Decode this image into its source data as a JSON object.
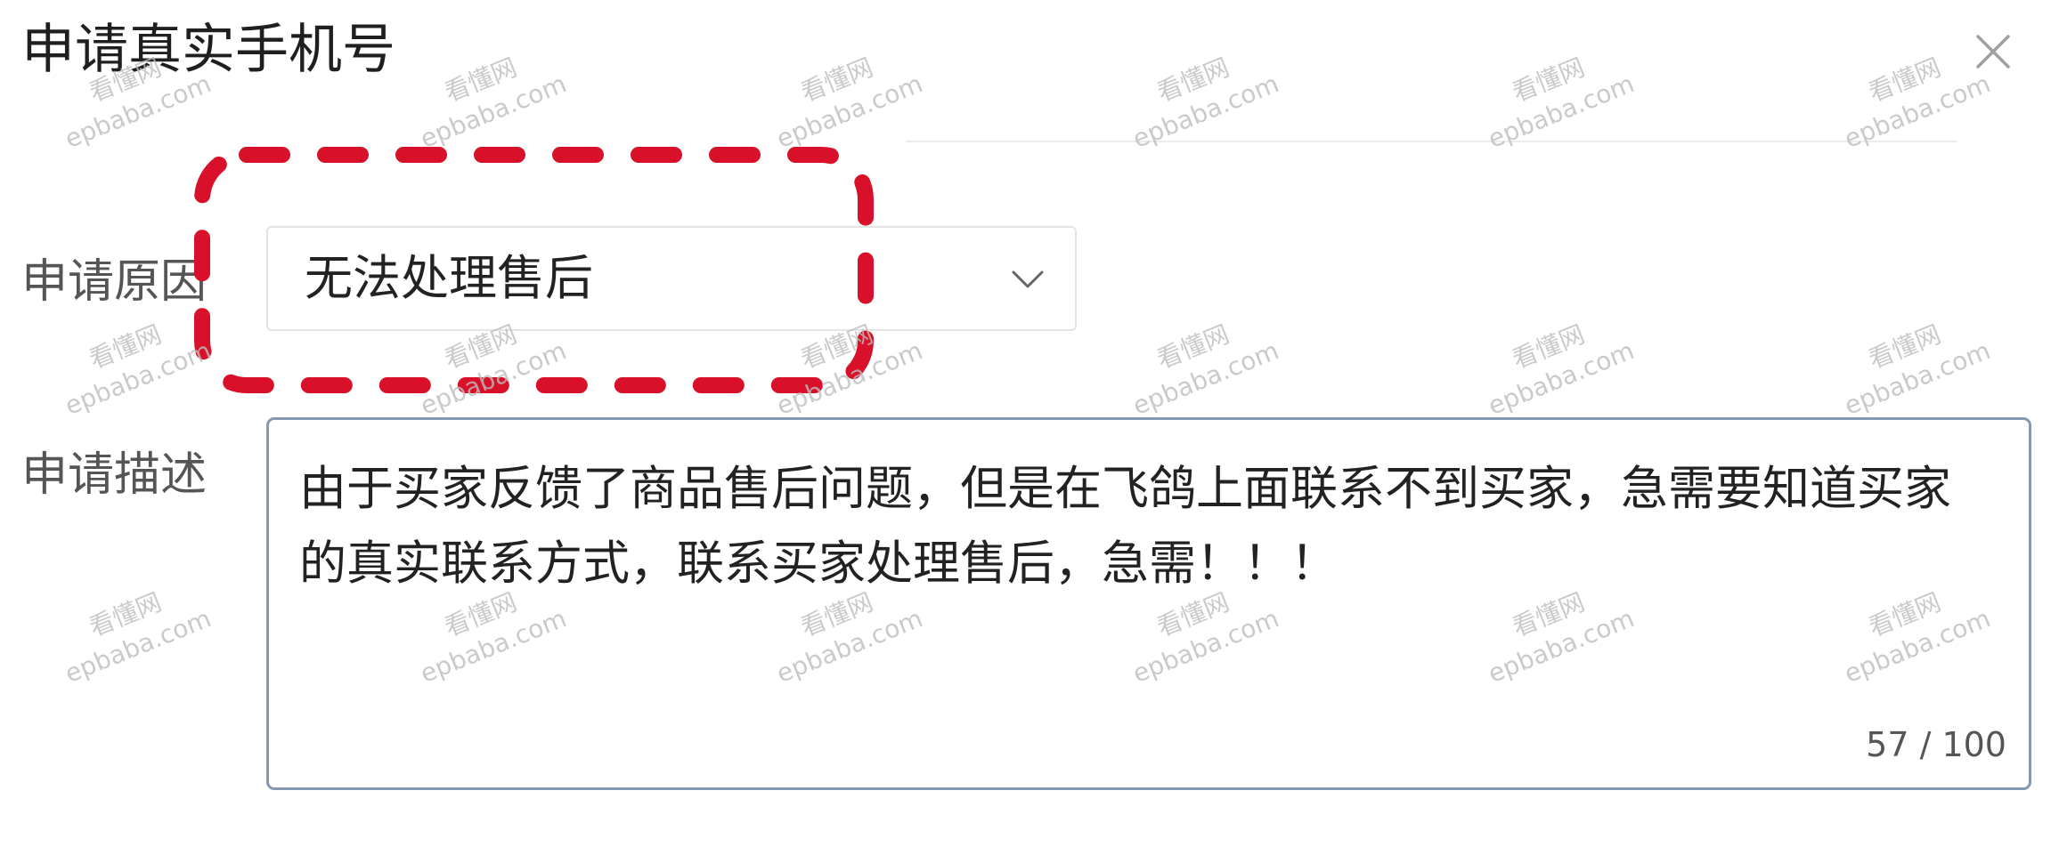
{
  "dialog": {
    "title": "申请真实手机号",
    "close_icon": "close-icon"
  },
  "form": {
    "reason": {
      "label": "申请原因",
      "selected": "无法处理售后",
      "icon": "chevron-down-icon"
    },
    "description": {
      "label": "申请描述",
      "lines": [
        "由于买家反馈了商品售后问题，但是在飞鸽上面联系不到买家，急需要知道买家",
        "的真实联系方式，联系买家处理售后，急需！！！"
      ],
      "counter": "57 / 100",
      "border_color": "#8497b3"
    }
  },
  "annotation": {
    "color": "#d8102a"
  },
  "watermark": {
    "brand": "看懂网",
    "domain": "epbaba.com",
    "color": "#bdbdbd"
  }
}
